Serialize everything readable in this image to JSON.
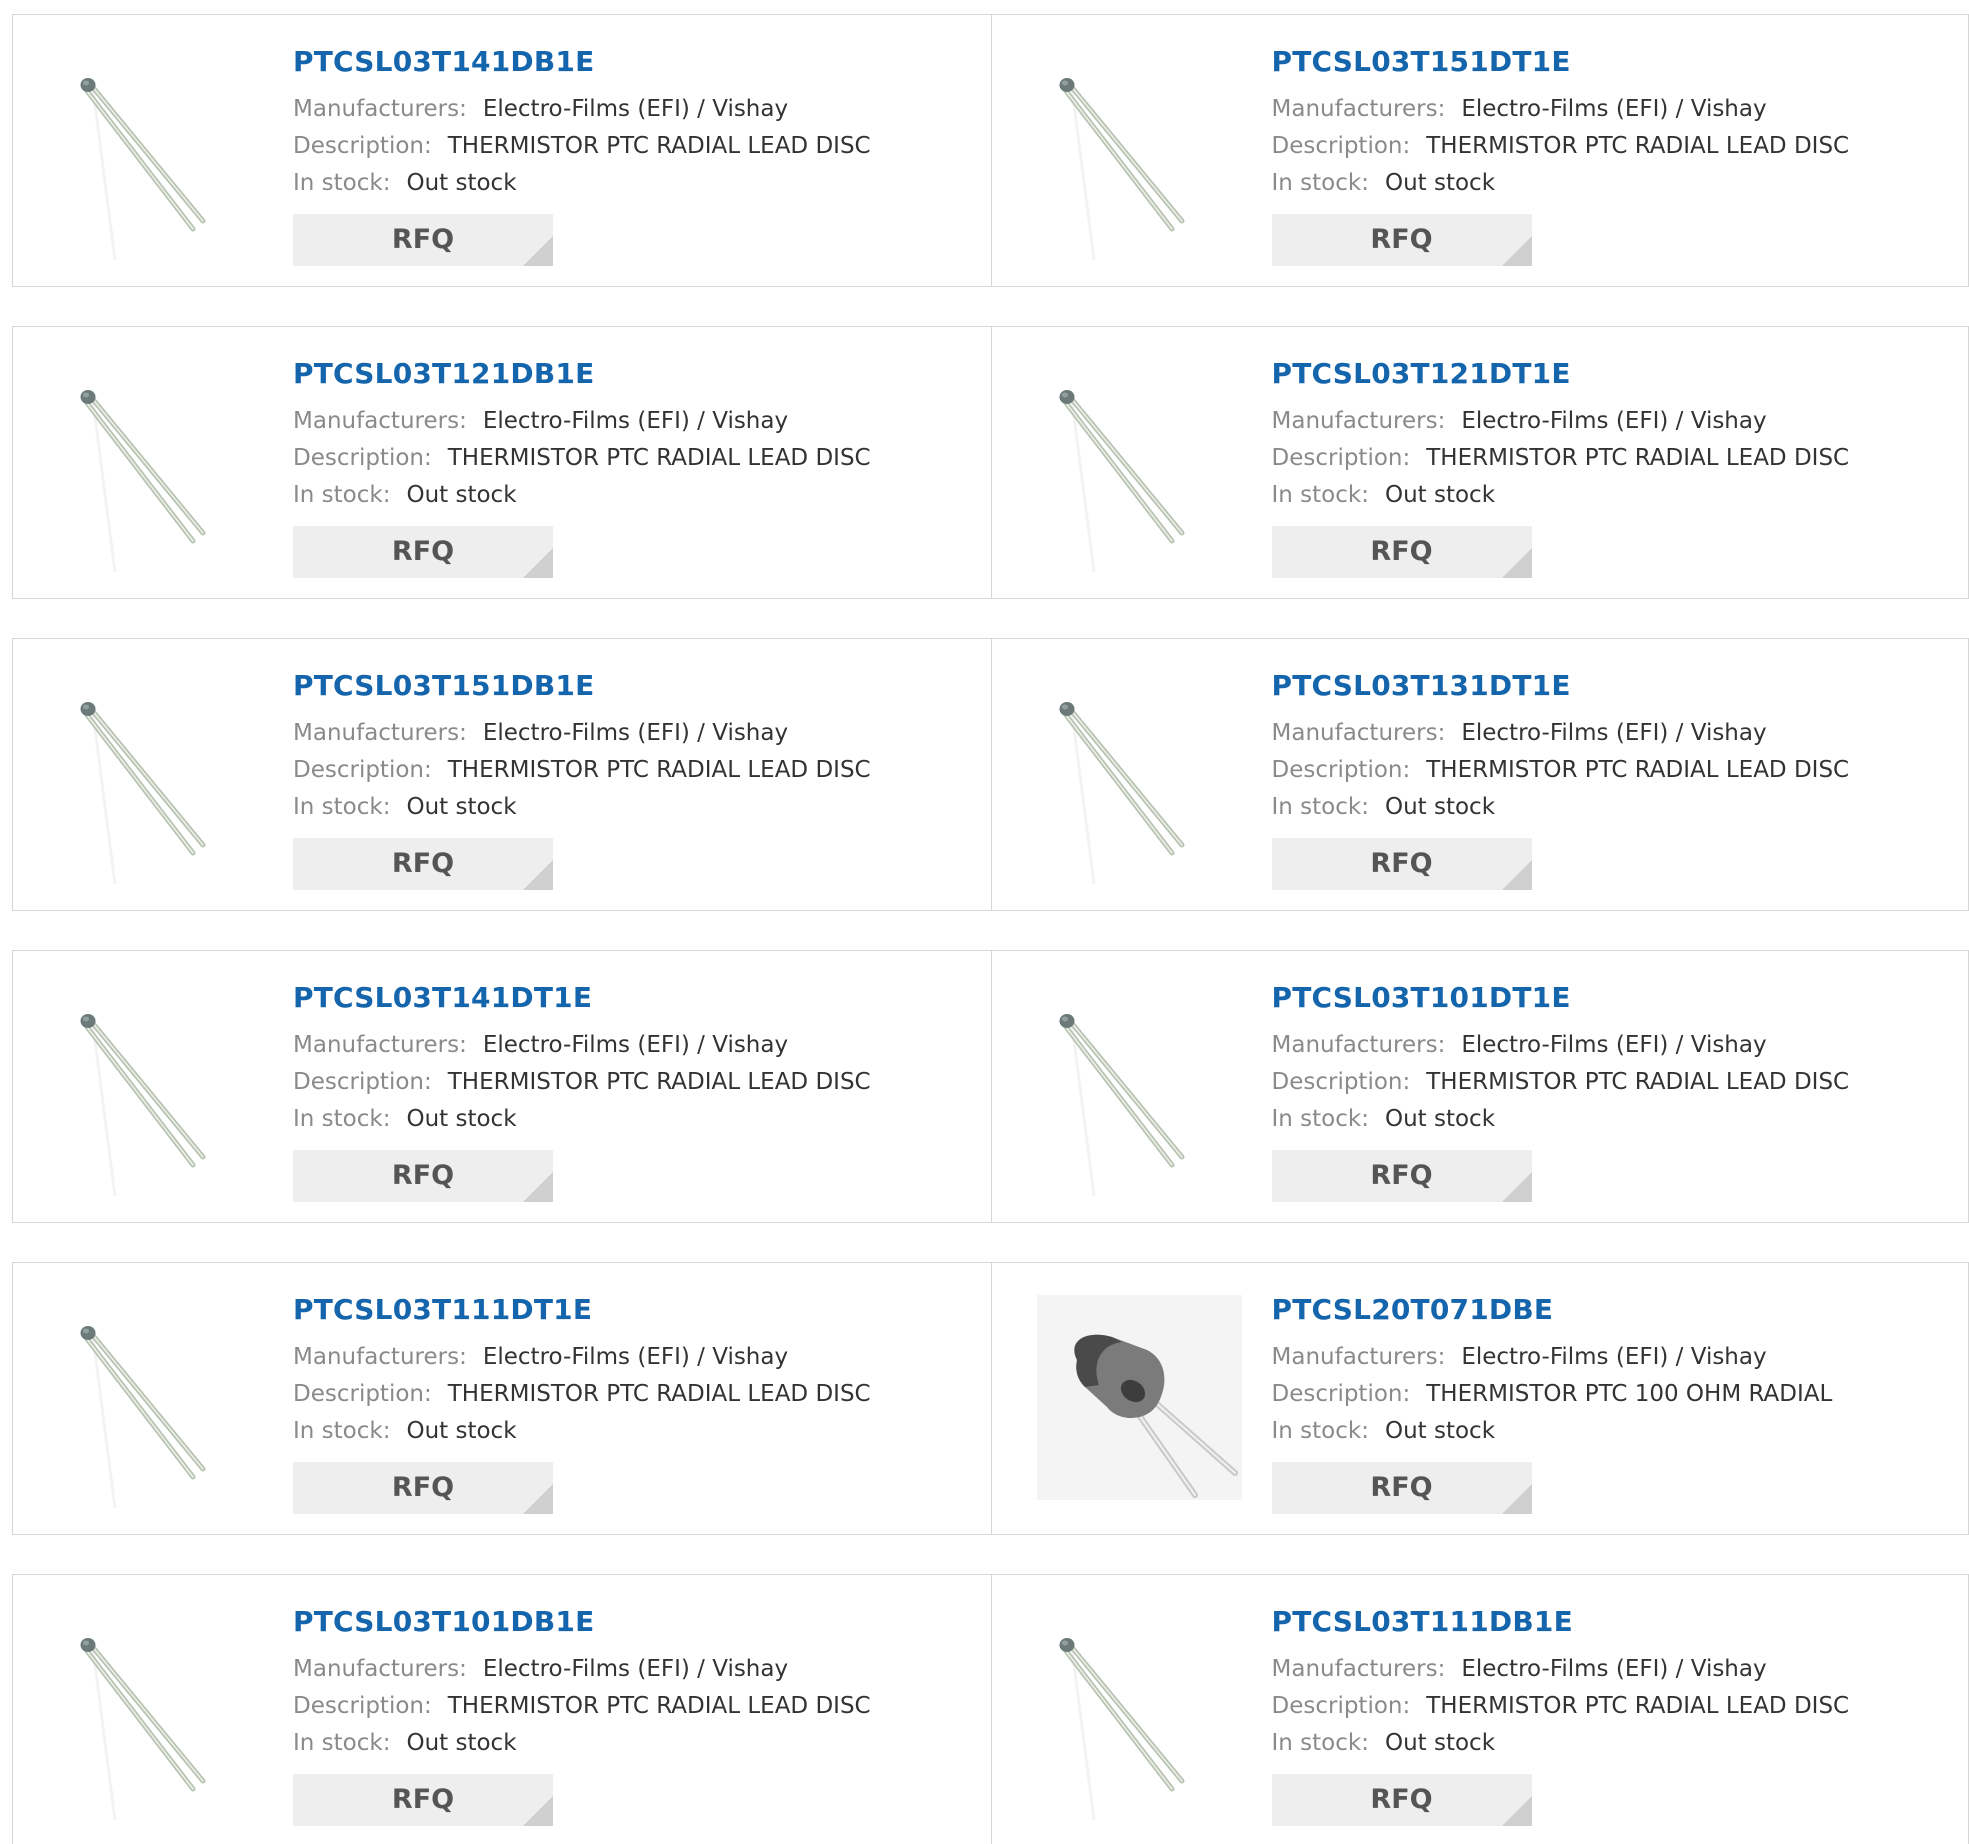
{
  "labels": {
    "manufacturers": "Manufacturers:",
    "description": "Description:",
    "in_stock": "In stock:",
    "rfq": "RFQ"
  },
  "products": [
    {
      "part": "PTCSL03T141DB1E",
      "manufacturer": "Electro-Films (EFI) / Vishay",
      "description": "THERMISTOR PTC RADIAL LEAD DISC",
      "stock": "Out stock",
      "image": "radial-disc-thermistor"
    },
    {
      "part": "PTCSL03T151DT1E",
      "manufacturer": "Electro-Films (EFI) / Vishay",
      "description": "THERMISTOR PTC RADIAL LEAD DISC",
      "stock": "Out stock",
      "image": "radial-disc-thermistor"
    },
    {
      "part": "PTCSL03T121DB1E",
      "manufacturer": "Electro-Films (EFI) / Vishay",
      "description": "THERMISTOR PTC RADIAL LEAD DISC",
      "stock": "Out stock",
      "image": "radial-disc-thermistor"
    },
    {
      "part": "PTCSL03T121DT1E",
      "manufacturer": "Electro-Films (EFI) / Vishay",
      "description": "THERMISTOR PTC RADIAL LEAD DISC",
      "stock": "Out stock",
      "image": "radial-disc-thermistor"
    },
    {
      "part": "PTCSL03T151DB1E",
      "manufacturer": "Electro-Films (EFI) / Vishay",
      "description": "THERMISTOR PTC RADIAL LEAD DISC",
      "stock": "Out stock",
      "image": "radial-disc-thermistor"
    },
    {
      "part": "PTCSL03T131DT1E",
      "manufacturer": "Electro-Films (EFI) / Vishay",
      "description": "THERMISTOR PTC RADIAL LEAD DISC",
      "stock": "Out stock",
      "image": "radial-disc-thermistor"
    },
    {
      "part": "PTCSL03T141DT1E",
      "manufacturer": "Electro-Films (EFI) / Vishay",
      "description": "THERMISTOR PTC RADIAL LEAD DISC",
      "stock": "Out stock",
      "image": "radial-disc-thermistor"
    },
    {
      "part": "PTCSL03T101DT1E",
      "manufacturer": "Electro-Films (EFI) / Vishay",
      "description": "THERMISTOR PTC RADIAL LEAD DISC",
      "stock": "Out stock",
      "image": "radial-disc-thermistor"
    },
    {
      "part": "PTCSL03T111DT1E",
      "manufacturer": "Electro-Films (EFI) / Vishay",
      "description": "THERMISTOR PTC RADIAL LEAD DISC",
      "stock": "Out stock",
      "image": "radial-disc-thermistor"
    },
    {
      "part": "PTCSL20T071DBE",
      "manufacturer": "Electro-Films (EFI) / Vishay",
      "description": "THERMISTOR PTC 100 OHM RADIAL",
      "stock": "Out stock",
      "image": "coated-disc-thermistor"
    },
    {
      "part": "PTCSL03T101DB1E",
      "manufacturer": "Electro-Films (EFI) / Vishay",
      "description": "THERMISTOR PTC RADIAL LEAD DISC",
      "stock": "Out stock",
      "image": "radial-disc-thermistor"
    },
    {
      "part": "PTCSL03T111DB1E",
      "manufacturer": "Electro-Films (EFI) / Vishay",
      "description": "THERMISTOR PTC RADIAL LEAD DISC",
      "stock": "Out stock",
      "image": "radial-disc-thermistor"
    }
  ],
  "colors": {
    "part_link": "#1565ad",
    "label": "#8a8a8a",
    "value": "#333333",
    "border": "#d6d6d6",
    "button_bg": "#eeeeee"
  }
}
